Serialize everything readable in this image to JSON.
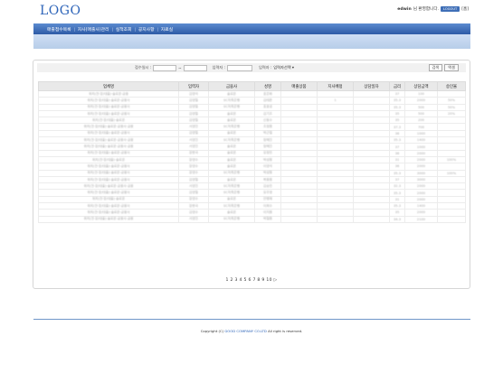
{
  "header": {
    "logo": "LOGO",
    "user_name": "edwin",
    "greeting": "님 환영합니다.",
    "logout": "LOGOUT",
    "bracket": "[홈]"
  },
  "nav": {
    "items": [
      "매출접수목록",
      "자사(매출사)관리",
      "실적조회",
      "공지사항",
      "자료실"
    ]
  },
  "search": {
    "date_label": "접수일시 :",
    "range_sep": "~",
    "receiver_label": "입력자 :",
    "agent_label": "입력자 :",
    "agent_select": "입력자선택 ▾",
    "search_button": "검색",
    "excel_button": "엑셀"
  },
  "table": {
    "headers": [
      "업체명",
      "입력자",
      "금융사",
      "성명",
      "매출상품",
      "지사배정",
      "상담일자",
      "금리",
      "상담금액",
      "승인율"
    ],
    "rows": [
      [
        "위치(전·장/대출)·솔로몬·금융",
        "김영석",
        "솔로몬",
        "표은화",
        "",
        "",
        "",
        "37",
        "100",
        ""
      ],
      [
        "위치(전·장/대출)·솔로몬·금융사",
        "김영철",
        "SC저축은행",
        "김태준",
        "",
        "1",
        "",
        "35.3",
        "2000",
        "50%"
      ],
      [
        "위치(전·장/대출)·솔로몬·금융사",
        "김영철",
        "SC저축은행",
        "표효성",
        "",
        "",
        "",
        "35.3",
        "500",
        "50%"
      ],
      [
        "위치(전·장/대출)·솔로몬·금융사",
        "김영철",
        "솔로몬",
        "김기조",
        "",
        "",
        "",
        "35",
        "500",
        "20%"
      ],
      [
        "위치(전·장/대출)·솔로몬",
        "김영철",
        "솔로몬",
        "신동수",
        "",
        "",
        "",
        "35",
        "200",
        ""
      ],
      [
        "위치(전·장/대출)·솔로몬·금융사·금융",
        "서영진",
        "SC저축은행",
        "조정원",
        "",
        "",
        "",
        "37.3",
        "700",
        ""
      ],
      [
        "위치(전·장/대출)·솔로몬·금융사",
        "김영철",
        "솔로몬",
        "박근철",
        "",
        "",
        "",
        "36",
        "1000",
        ""
      ],
      [
        "위치(전·장/대출)·솔로몬·금융사·금융",
        "서영진",
        "SC저축은행",
        "정혜진",
        "",
        "",
        "",
        "35.3",
        "1400",
        ""
      ],
      [
        "위치(전·장/대출)·솔로몬·금융사·금융",
        "서영진",
        "솔로몬",
        "정혜진",
        "",
        "",
        "",
        "37",
        "1000",
        ""
      ],
      [
        "위치(전·장/대출)·솔로몬·금융사",
        "장한국",
        "솔로몬",
        "유정민",
        "",
        "",
        "",
        "36",
        "2000",
        ""
      ],
      [
        "위치(전·장/대출)·솔로몬",
        "장영수",
        "솔로몬",
        "박성원",
        "",
        "",
        "",
        "31",
        "2000",
        "100%"
      ],
      [
        "위치(전·장/대출)·솔로몬·금융사",
        "장영수",
        "솔로몬",
        "이영석",
        "",
        "",
        "",
        "36",
        "2000",
        ""
      ],
      [
        "위치(전·장/대출)·솔로몬·금융사",
        "장영수",
        "SC저축은행",
        "박성원",
        "",
        "",
        "",
        "35.3",
        "3000",
        "100%"
      ],
      [
        "위치(전·장/대출)·솔로몬·금융사",
        "김영철",
        "솔로몬",
        "복종원",
        "",
        "",
        "",
        "37",
        "3000",
        ""
      ],
      [
        "위치(전·장/대출)·솔로몬·금융사·금융",
        "서영진",
        "SC저축은행",
        "김승민",
        "",
        "",
        "",
        "32.3",
        "2000",
        ""
      ],
      [
        "위치(전·장/대출)·솔로몬·금융사",
        "김영철",
        "SC저축은행",
        "유주영",
        "",
        "",
        "",
        "35.3",
        "2000",
        ""
      ],
      [
        "위치(전·장/대출)·솔로몬",
        "장영수",
        "솔로몬",
        "안병채",
        "",
        "",
        "",
        "31",
        "2000",
        ""
      ],
      [
        "위치(전·장/대출)·솔로몬·금융사",
        "장한국",
        "SC저축은행",
        "이희수",
        "",
        "",
        "",
        "35.3",
        "1400",
        ""
      ],
      [
        "위치(전·장/대출)·솔로몬·금융사",
        "김영수",
        "솔로몬",
        "이지원",
        "",
        "",
        "",
        "35",
        "2000",
        ""
      ],
      [
        "위치(전·장/대출)·솔로몬·금융사·금융",
        "서영진",
        "SC저축은행",
        "박철원",
        "",
        "",
        "",
        "34.3",
        "2100",
        ""
      ]
    ]
  },
  "pager": {
    "text": "1 2 3 4 5 6 7 8 9 10 ▷"
  },
  "footer": {
    "prefix": "Copyright (C)",
    "company": "GOOD COMPANY CO.LTD",
    "suffix": "All right is reserved."
  }
}
